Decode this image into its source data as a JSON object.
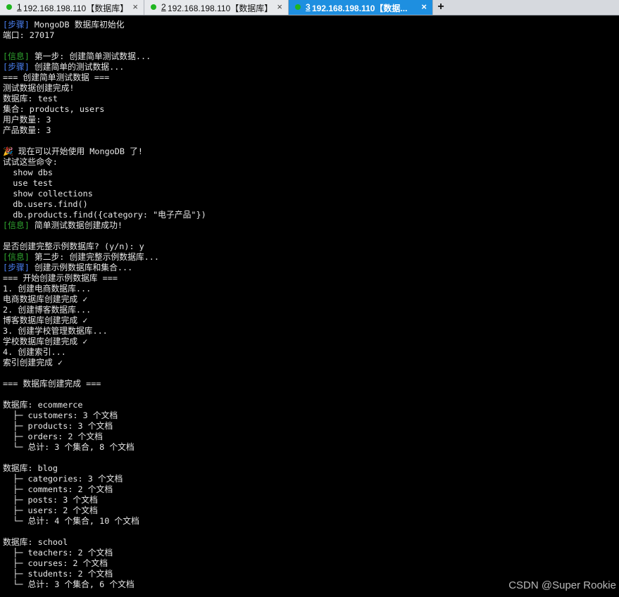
{
  "tabs": [
    {
      "number": "1",
      "title": "192.168.198.110【数据库】",
      "status_color": "#1fb51f",
      "active": false
    },
    {
      "number": "2",
      "title": "192.168.198.110【数据库】",
      "status_color": "#1fb51f",
      "active": false
    },
    {
      "number": "3",
      "title": "192.168.198.110【数据...",
      "status_color": "#1fb51f",
      "active": true
    }
  ],
  "new_tab_label": "+",
  "close_glyph": "×",
  "colors": {
    "step": "#4a7ff0",
    "info": "#2fa52f",
    "text": "#e8e8e8",
    "background": "#000000",
    "active_tab": "#1e8fe0"
  },
  "terminal_lines": [
    {
      "tag": "[步骤]",
      "type": "step",
      "text": " MongoDB 数据库初始化"
    },
    {
      "text": "端口: 27017"
    },
    {
      "text": ""
    },
    {
      "tag": "[信息]",
      "type": "info",
      "text": " 第一步: 创建简单测试数据..."
    },
    {
      "tag": "[步骤]",
      "type": "step",
      "text": " 创建简单的测试数据..."
    },
    {
      "text": "=== 创建简单测试数据 ==="
    },
    {
      "text": "测试数据创建完成!"
    },
    {
      "text": "数据库: test"
    },
    {
      "text": "集合: products, users"
    },
    {
      "text": "用户数量: 3"
    },
    {
      "text": "产品数量: 3"
    },
    {
      "text": ""
    },
    {
      "text": "🎉 现在可以开始使用 MongoDB 了!"
    },
    {
      "text": "试试这些命令:"
    },
    {
      "text": "  show dbs"
    },
    {
      "text": "  use test"
    },
    {
      "text": "  show collections"
    },
    {
      "text": "  db.users.find()"
    },
    {
      "text": "  db.products.find({category: \"电子产品\"})"
    },
    {
      "tag": "[信息]",
      "type": "info",
      "text": " 简单测试数据创建成功!"
    },
    {
      "text": ""
    },
    {
      "text": "是否创建完整示例数据库? (y/n): y"
    },
    {
      "tag": "[信息]",
      "type": "info",
      "text": " 第二步: 创建完整示例数据库..."
    },
    {
      "tag": "[步骤]",
      "type": "step",
      "text": " 创建示例数据库和集合..."
    },
    {
      "text": "=== 开始创建示例数据库 ==="
    },
    {
      "text": "1. 创建电商数据库..."
    },
    {
      "text": "电商数据库创建完成 ✓"
    },
    {
      "text": "2. 创建博客数据库..."
    },
    {
      "text": "博客数据库创建完成 ✓"
    },
    {
      "text": "3. 创建学校管理数据库..."
    },
    {
      "text": "学校数据库创建完成 ✓"
    },
    {
      "text": "4. 创建索引..."
    },
    {
      "text": "索引创建完成 ✓"
    },
    {
      "text": ""
    },
    {
      "text": "=== 数据库创建完成 ==="
    },
    {
      "text": ""
    },
    {
      "text": "数据库: ecommerce"
    },
    {
      "text": "  ├─ customers: 3 个文档"
    },
    {
      "text": "  ├─ products: 3 个文档"
    },
    {
      "text": "  ├─ orders: 2 个文档"
    },
    {
      "text": "  └─ 总计: 3 个集合, 8 个文档"
    },
    {
      "text": ""
    },
    {
      "text": "数据库: blog"
    },
    {
      "text": "  ├─ categories: 3 个文档"
    },
    {
      "text": "  ├─ comments: 2 个文档"
    },
    {
      "text": "  ├─ posts: 3 个文档"
    },
    {
      "text": "  ├─ users: 2 个文档"
    },
    {
      "text": "  └─ 总计: 4 个集合, 10 个文档"
    },
    {
      "text": ""
    },
    {
      "text": "数据库: school"
    },
    {
      "text": "  ├─ teachers: 2 个文档"
    },
    {
      "text": "  ├─ courses: 2 个文档"
    },
    {
      "text": "  ├─ students: 2 个文档"
    },
    {
      "text": "  └─ 总计: 3 个集合, 6 个文档"
    }
  ],
  "watermark": "CSDN @Super Rookie"
}
